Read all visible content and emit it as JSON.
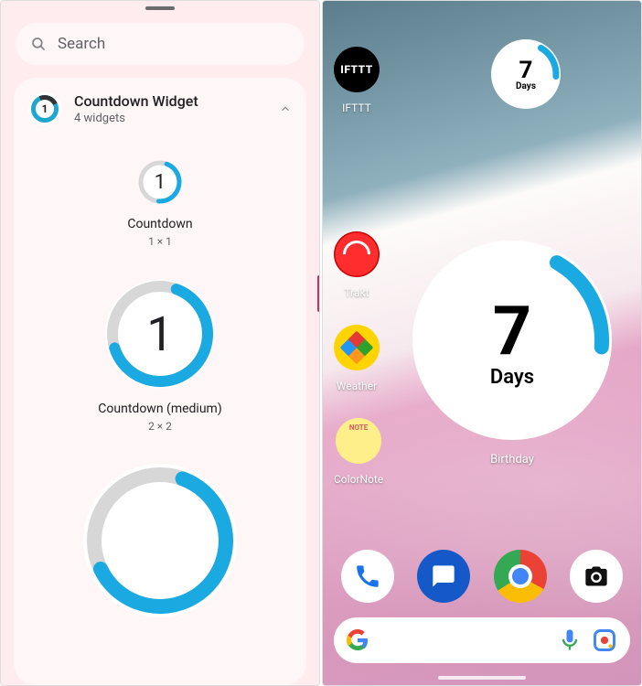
{
  "left": {
    "search_placeholder": "Search",
    "card": {
      "title": "Countdown Widget",
      "subtitle": "4 widgets",
      "icon_value": "1"
    },
    "previews": [
      {
        "id": "small",
        "value": "1",
        "label": "Countdown",
        "size": "1 × 1"
      },
      {
        "id": "medium",
        "value": "1",
        "label": "Countdown (medium)",
        "size": "2 × 2"
      }
    ]
  },
  "right": {
    "apps": {
      "ifttt": {
        "label": "IFTTT",
        "badge": "IFTTT"
      },
      "trakt": {
        "label": "Trakt"
      },
      "weather": {
        "label": "Weather"
      },
      "colornote": {
        "label": "ColorNote"
      }
    },
    "widgets": {
      "small": {
        "value": "7",
        "unit": "Days"
      },
      "big": {
        "value": "7",
        "unit": "Days",
        "label": "Birthday"
      }
    },
    "colors": {
      "accent": "#1aa9e0"
    }
  }
}
